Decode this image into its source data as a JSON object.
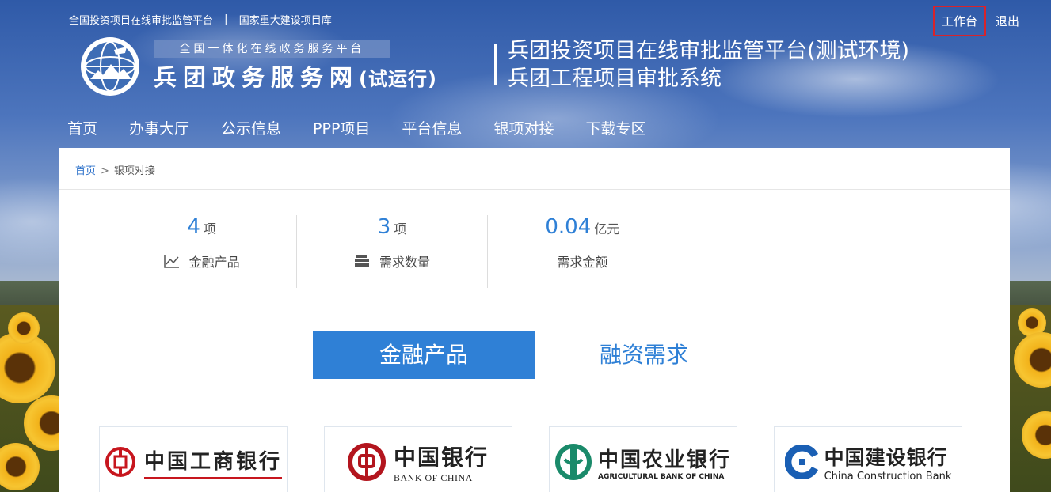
{
  "header": {
    "top_link_1": "全国投资项目在线审批监管平台",
    "separator": "|",
    "top_link_2": "国家重大建设项目库",
    "workbench": "工作台",
    "logout": "退出",
    "logo_tagline": "全国一体化在线政务服务平台",
    "logo_name": "兵团政务服务网",
    "logo_suffix": "(试运行)",
    "system_title_1": "兵团投资项目在线审批监管平台(测试环境)",
    "system_title_2": "兵团工程项目审批系统"
  },
  "nav": {
    "items": [
      "首页",
      "办事大厅",
      "公示信息",
      "PPP项目",
      "平台信息",
      "银项对接",
      "下载专区"
    ],
    "active_index": 0
  },
  "breadcrumb": {
    "home": "首页",
    "separator": ">",
    "current": "银项对接"
  },
  "stats": [
    {
      "value": "4",
      "unit": "项",
      "label": "金融产品",
      "icon": "line-chart-icon"
    },
    {
      "value": "3",
      "unit": "项",
      "label": "需求数量",
      "icon": "stack-icon"
    },
    {
      "value": "0.04",
      "unit": "亿元",
      "label": "需求金额",
      "icon": ""
    }
  ],
  "tabs": {
    "financial_products": "金融产品",
    "financing_needs": "融资需求",
    "active": "financial_products"
  },
  "banks": [
    {
      "cn": "中国工商银行",
      "en": "",
      "color": "#c7161e"
    },
    {
      "cn": "中国银行",
      "en": "BANK OF CHINA",
      "color": "#b3151e"
    },
    {
      "cn": "中国农业银行",
      "en": "AGRICULTURAL BANK OF CHINA",
      "color": "#1a8a6a"
    },
    {
      "cn": "中国建设银行",
      "en": "China Construction Bank",
      "color": "#1a5fb4"
    }
  ],
  "colors": {
    "accent": "#2f80d6",
    "nav_active_underline": "#f5a623",
    "highlight_border": "#d9232a"
  }
}
